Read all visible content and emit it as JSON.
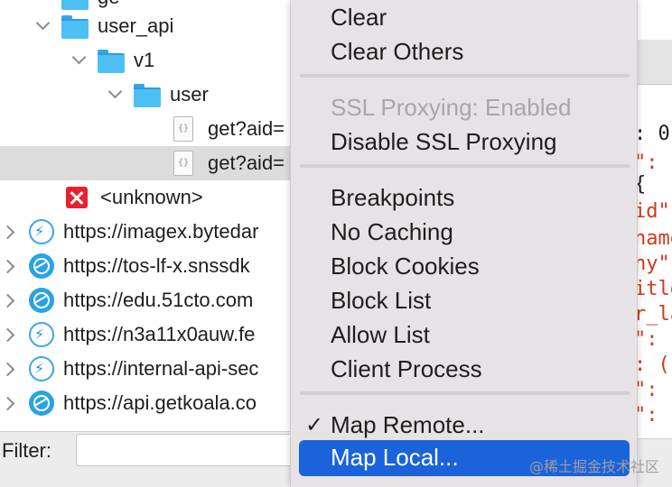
{
  "tree": {
    "rows": [
      {
        "label": "user_api"
      },
      {
        "label": "v1"
      },
      {
        "label": "user"
      },
      {
        "label": "get?aid="
      },
      {
        "label": "get?aid="
      },
      {
        "label": "<unknown>"
      },
      {
        "label": "https://imagex.bytedar"
      },
      {
        "label": "https://tos-lf-x.snssdk"
      },
      {
        "label": "https://edu.51cto.com"
      },
      {
        "label": "https://n3a11x0auw.fe"
      },
      {
        "label": "https://internal-api-sec"
      },
      {
        "label": "https://api.getkoala.co"
      }
    ],
    "top_partial": "ge"
  },
  "filter": {
    "label": "Filter:",
    "value": ""
  },
  "menu": {
    "items": [
      {
        "label": "Clear"
      },
      {
        "label": "Clear Others"
      },
      {
        "label": "SSL Proxying: Enabled"
      },
      {
        "label": "Disable SSL Proxying"
      },
      {
        "label": "Breakpoints"
      },
      {
        "label": "No Caching"
      },
      {
        "label": "Block Cookies"
      },
      {
        "label": "Block List"
      },
      {
        "label": "Allow List"
      },
      {
        "label": "Client Process"
      },
      {
        "label": "Map Remote...",
        "checked": "✓"
      },
      {
        "label": "Map Local..."
      }
    ]
  },
  "code": {
    "lines": [
      {
        "text": ": 0"
      },
      {
        "text": "\": \""
      },
      {
        "text": "{"
      },
      {
        "text": "id\""
      },
      {
        "text": "name"
      },
      {
        "text": "ny\""
      },
      {
        "text": "itle"
      },
      {
        "text": "r_la"
      },
      {
        "text": "\": ("
      },
      {
        "text": ": ("
      },
      {
        "text": "\": ("
      },
      {
        "text": "\": ("
      }
    ]
  },
  "watermark": "@稀土掘金技术社区"
}
